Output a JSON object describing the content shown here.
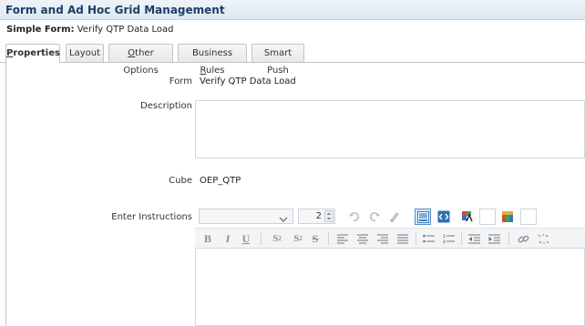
{
  "window": {
    "title": "Form and Ad Hoc Grid Management"
  },
  "form_header": {
    "prefix": "Simple Form:",
    "name": "Verify QTP Data Load"
  },
  "tabs": [
    {
      "label": "Properties",
      "u": "P",
      "rest": "roperties",
      "active": true
    },
    {
      "label": "Layout"
    },
    {
      "label": "Other Options",
      "u": "O",
      "rest": "ther Options"
    },
    {
      "label": "Business Rules",
      "pre": "Business ",
      "u": "R",
      "rest": "ules"
    },
    {
      "label": "Smart Push"
    }
  ],
  "properties": {
    "form_label": "Form",
    "form_value": "Verify QTP Data Load",
    "description_label": "Description",
    "description_value": "",
    "cube_label": "Cube",
    "cube_value": "OEP_QTP",
    "instructions_label": "Enter Instructions",
    "font_select_value": "",
    "font_size_value": "2"
  },
  "colors": {
    "title_text": "#1d3f66",
    "accent": "#5a8fc9"
  }
}
